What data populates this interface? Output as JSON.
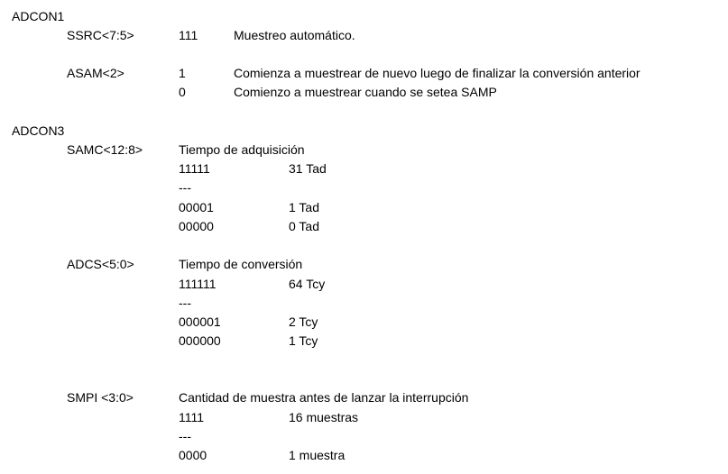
{
  "adcon1": {
    "title": "ADCON1",
    "ssrc": {
      "field": "SSRC<7:5>",
      "value": "111",
      "description": "Muestreo automático."
    },
    "asam": {
      "field": "ASAM<2>",
      "rows": [
        {
          "value": "1",
          "description": "Comienza a muestrear de nuevo luego de finalizar la conversión anterior"
        },
        {
          "value": "0",
          "description": "Comienzo a muestrear cuando se setea SAMP"
        }
      ]
    }
  },
  "adcon3": {
    "title": "ADCON3",
    "samc": {
      "field": "SAMC<12:8>",
      "heading": "Tiempo de adquisición",
      "rows": [
        {
          "code": "11111",
          "result": "31 Tad"
        },
        {
          "code": "---",
          "result": ""
        },
        {
          "code": "00001",
          "result": "1 Tad"
        },
        {
          "code": "00000",
          "result": "0 Tad"
        }
      ]
    },
    "adcs": {
      "field": "ADCS<5:0>",
      "heading": "Tiempo de conversión",
      "rows": [
        {
          "code": "111111",
          "result": "64 Tcy"
        },
        {
          "code": "---",
          "result": ""
        },
        {
          "code": "000001",
          "result": "2 Tcy"
        },
        {
          "code": "000000",
          "result": "1 Tcy"
        }
      ]
    },
    "smpi": {
      "field": "SMPI <3:0>",
      "heading": "Cantidad de muestra antes de lanzar la interrupción",
      "rows": [
        {
          "code": "1111",
          "result": "16 muestras"
        },
        {
          "code": "---",
          "result": ""
        },
        {
          "code": "0000",
          "result": "1 muestra"
        }
      ]
    }
  }
}
